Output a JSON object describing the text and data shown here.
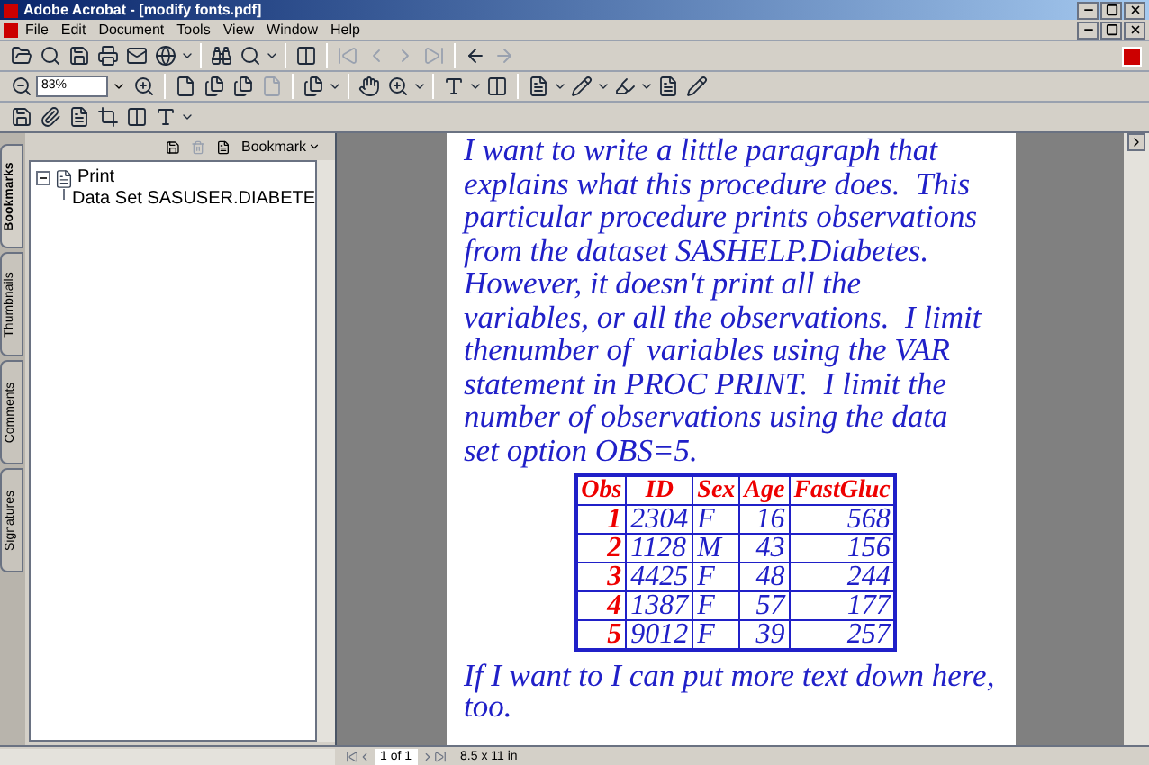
{
  "window": {
    "title": "Adobe Acrobat - [modify fonts.pdf]"
  },
  "menu": [
    "File",
    "Edit",
    "Document",
    "Tools",
    "View",
    "Window",
    "Help"
  ],
  "toolbar": {
    "zoom": "83%"
  },
  "panel": {
    "tabs": [
      {
        "label": "Bookmarks",
        "selected": true
      },
      {
        "label": "Thumbnails",
        "selected": false
      },
      {
        "label": "Comments",
        "selected": false
      },
      {
        "label": "Signatures",
        "selected": false
      }
    ],
    "bookmark_button": "Bookmark",
    "tree": [
      {
        "label": "Print",
        "expanded": true,
        "children": [
          {
            "label": "Data Set SASUSER.DIABETE"
          }
        ]
      }
    ]
  },
  "document": {
    "paragraph": "I want to write a little paragraph that explains what this procedure does.  This particular procedure prints observations from the dataset SASHELP.Diabetes. However, it doesn't print all the variables, or all the observations.  I limit thenumber of  variables using the VAR statement in PROC PRINT.  I limit the number of observations using the data set option OBS=5.",
    "table": {
      "columns": [
        "Obs",
        "ID",
        "Sex",
        "Age",
        "FastGluc"
      ],
      "rows": [
        [
          "1",
          "2304",
          "F",
          "16",
          "568"
        ],
        [
          "2",
          "1128",
          "M",
          "43",
          "156"
        ],
        [
          "3",
          "4425",
          "F",
          "48",
          "244"
        ],
        [
          "4",
          "1387",
          "F",
          "57",
          "177"
        ],
        [
          "5",
          "9012",
          "F",
          "39",
          "257"
        ]
      ]
    },
    "closing": "If I want to I can put more text down here, too."
  },
  "status_bar": {
    "page": "1 of 1",
    "size": "8.5 x 11 in"
  }
}
